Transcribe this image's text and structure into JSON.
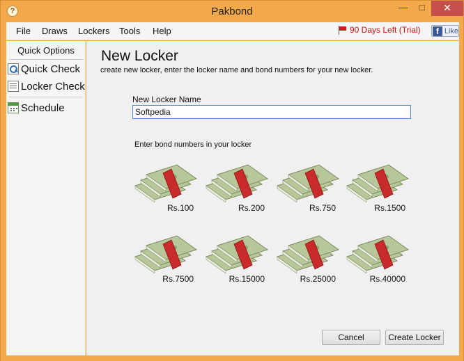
{
  "window": {
    "title": "Pakbond",
    "app_icon": "question-mark-icon"
  },
  "menu": {
    "items": [
      "File",
      "Draws",
      "Lockers",
      "Tools",
      "Help"
    ],
    "trial": "90 Days Left (Trial)",
    "like": "Like"
  },
  "sidebar": {
    "header": "Quick Options",
    "items": [
      {
        "label": "Quick Check",
        "icon": "magnifier-icon"
      },
      {
        "label": "Locker Check",
        "icon": "list-check-icon"
      },
      {
        "label": "Schedule",
        "icon": "calendar-icon"
      }
    ]
  },
  "main": {
    "title": "New Locker",
    "subtitle": "create new locker, enter the locker name and bond numbers for your new locker.",
    "name_label": "New Locker Name",
    "name_value": "Softpedia",
    "bonds_label": "Enter bond numbers in your locker",
    "bonds": [
      "Rs.100",
      "Rs.200",
      "Rs.750",
      "Rs.1500",
      "Rs.7500",
      "Rs.15000",
      "Rs.25000",
      "Rs.40000"
    ],
    "cancel": "Cancel",
    "create": "Create Locker"
  },
  "colors": {
    "chrome": "#f3a94a",
    "close": "#c74f4b",
    "trial": "#cc1111",
    "band": "#c92a2a",
    "money": "#b7c79a"
  }
}
